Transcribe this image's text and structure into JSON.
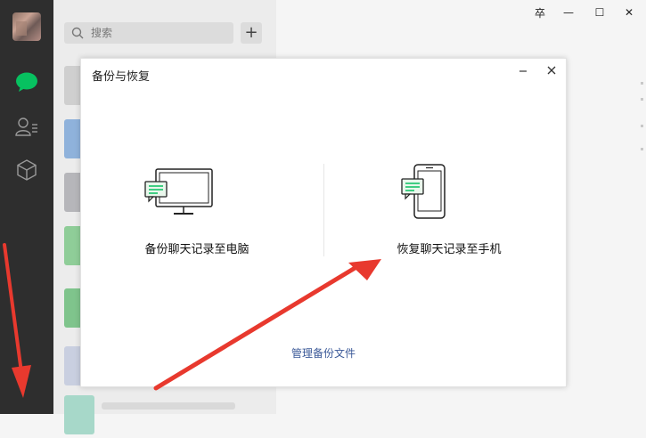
{
  "window": {
    "pin_glyph": "卒",
    "minimize_glyph": "—",
    "maximize_glyph": "☐",
    "close_glyph": "✕"
  },
  "search": {
    "placeholder": "搜索",
    "add_glyph": "+"
  },
  "dialog": {
    "title": "备份与恢复",
    "backup_label": "备份聊天记录至电脑",
    "restore_label": "恢复聊天记录至手机",
    "manage_label": "管理备份文件"
  },
  "colors": {
    "sidebar": "#2e2e2e",
    "accent_green": "#07c160",
    "annotation_red": "#e8392e",
    "link_blue": "#3b5998"
  },
  "icons": {
    "chat": "chat-bubble-icon",
    "contacts": "contacts-icon",
    "favorites": "cube-icon"
  }
}
